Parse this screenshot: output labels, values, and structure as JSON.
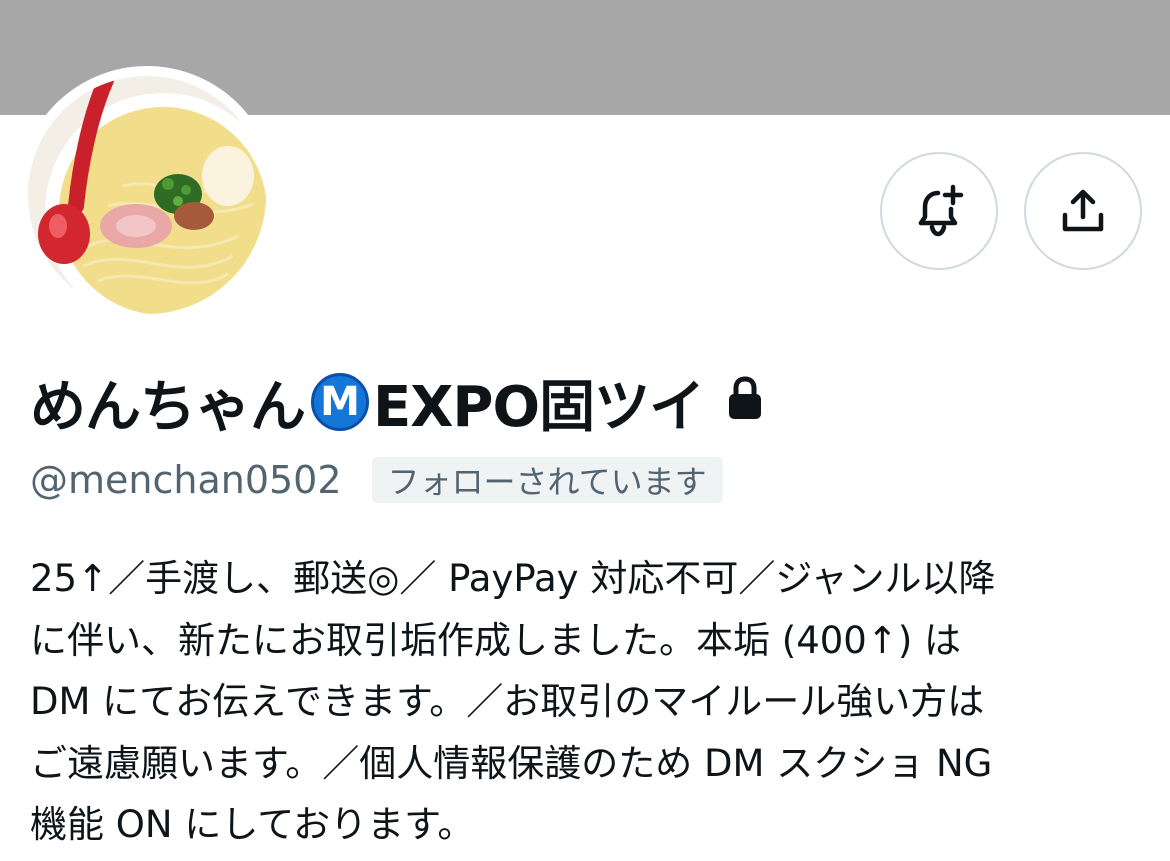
{
  "profile": {
    "display_name": "めんちゃん",
    "name_badge": "M",
    "name_suffix": "EXPO固ツイ",
    "handle": "@menchan0502",
    "follows_you_label": "フォローされています",
    "protected_icon": "lock-icon",
    "bio_lines": [
      "25↑／手渡し、郵送◎／ PayPay 対応不可／ジャンル以降",
      "に伴い、新たにお取引垢作成しました。本垢 (400↑) は",
      "DM にてお伝えできます。／お取引のマイルール強い方は",
      "ご遠慮願います。／個人情報保護のため DM スクショ NG",
      "機能 ON にしております。"
    ]
  },
  "actions": {
    "notify_icon": "bell-plus-icon",
    "share_icon": "share-icon"
  },
  "colors": {
    "banner": "#a7a7a7",
    "text_primary": "#0f1419",
    "text_secondary": "#536471",
    "badge_blue": "#1476d6",
    "chip_background": "#eff3f4",
    "button_border": "#cfd9de"
  }
}
